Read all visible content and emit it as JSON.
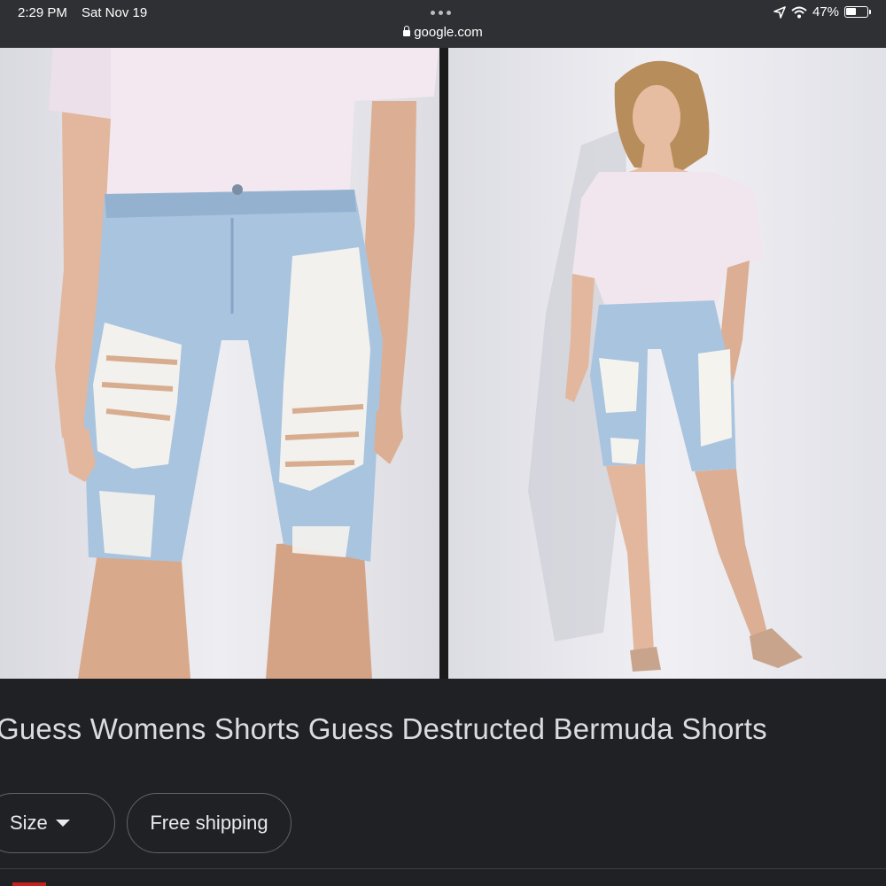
{
  "status_bar": {
    "time": "2:29 PM",
    "date": "Sat Nov 19",
    "url": "google.com",
    "battery": "47%"
  },
  "product": {
    "title": "Guess Womens Shorts Guess Destructed Bermuda Shorts",
    "images": [
      "close-up of distressed bermuda denim shorts",
      "model wearing top and distressed bermuda shorts"
    ]
  },
  "filters": {
    "size_label": "Size",
    "shipping_label": "Free shipping"
  },
  "colors": {
    "background": "#202124",
    "denim": "#a9c4df",
    "top": "#f1e6ee"
  }
}
